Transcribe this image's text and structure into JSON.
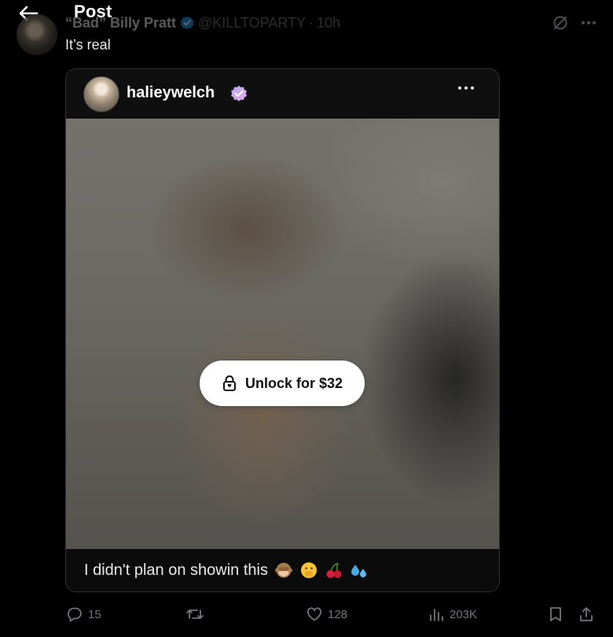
{
  "header": {
    "title": "Post"
  },
  "tweet": {
    "author_name": "“Bad” Billy Pratt",
    "handle": "@KILLTOPARTY",
    "separator": "·",
    "time": "10h",
    "text": "It’s real"
  },
  "card": {
    "username": "halieywelch",
    "unlock_label": "Unlock for $32",
    "caption": "I didn't plan on showin this",
    "caption_emojis": [
      "see-no-evil-monkey",
      "face-with-hand-over-mouth",
      "cherries",
      "sweat-droplets"
    ]
  },
  "actions": {
    "replies": "15",
    "reposts": "",
    "likes": "128",
    "views": "203K"
  },
  "icons": {
    "back": "arrow-left-icon",
    "verified": "verified-badge-icon",
    "grok": "grok-icon",
    "more": "more-horizontal-icon",
    "lock": "lock-icon",
    "reply": "reply-icon",
    "repost": "repost-icon",
    "like": "heart-icon",
    "views": "views-icon",
    "bookmark": "bookmark-icon",
    "share": "share-icon"
  },
  "colors": {
    "background": "#000000",
    "text": "#e7e9ea",
    "muted": "#71767b",
    "verified_blue": "#1d9bf0",
    "card_bg": "#111111",
    "unlock_button": "#ffffff"
  }
}
